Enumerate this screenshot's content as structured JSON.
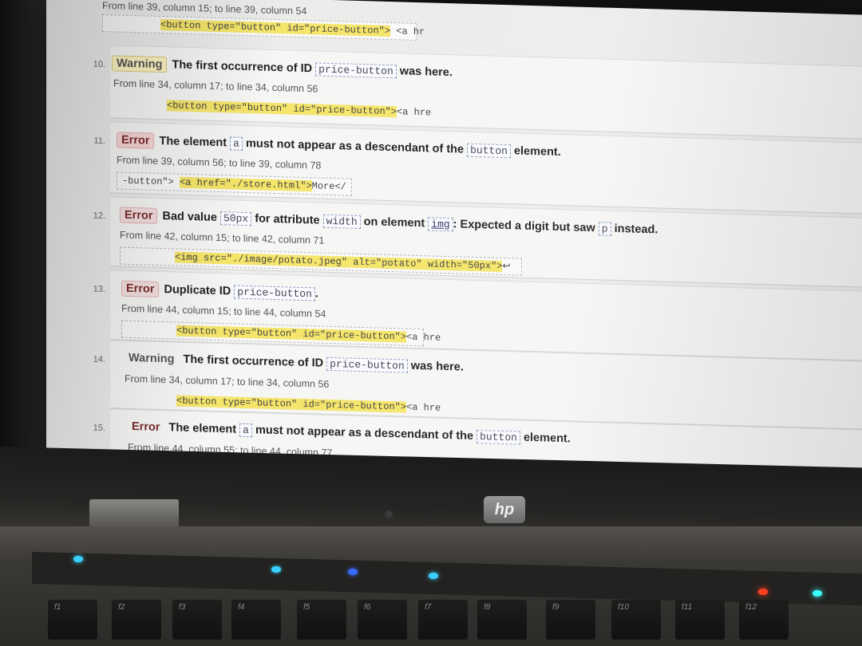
{
  "top_partial": {
    "location": "From line 39, column 15; to line 39, column 54",
    "extract_hl": "<button type=\"button\" id=\"price-button\">",
    "extract_rest": " <a hr"
  },
  "messages": [
    {
      "number": "10.",
      "type": "Warning",
      "parts": [
        "The first occurrence of ID ",
        "price-button",
        " was here."
      ],
      "location": "From line 34, column 17; to line 34, column 56",
      "extract_pre": "",
      "extract_hl": "<button type=\"button\" id=\"price-button\">",
      "extract_post": "<a hre"
    },
    {
      "number": "11.",
      "type": "Error",
      "parts": [
        "The element ",
        "a",
        " must not appear as a descendant of the ",
        "button",
        " element."
      ],
      "location": "From line 39, column 56; to line 39, column 78",
      "extract_pre": "-button\"> ",
      "extract_hl": "<a href=\"./store.html\">",
      "extract_post": "More</"
    },
    {
      "number": "12.",
      "type": "Error",
      "parts": [
        "Bad value ",
        "50px",
        " for attribute ",
        "width",
        " on element ",
        "img",
        ": Expected a digit but saw ",
        "p",
        " instead."
      ],
      "location": "From line 42, column 15; to line 42, column 71",
      "extract_pre": "",
      "extract_hl": "<img src=\"./image/potato.jpeg\" alt=\"potato\" width=\"50px\">",
      "extract_post": "↩"
    },
    {
      "number": "13.",
      "type": "Error",
      "parts": [
        "Duplicate ID ",
        "price-button",
        "."
      ],
      "location": "From line 44, column 15; to line 44, column 54",
      "extract_pre": "",
      "extract_hl": "<button type=\"button\" id=\"price-button\">",
      "extract_post": "<a hre"
    },
    {
      "number": "14.",
      "type": "Warning",
      "parts": [
        "The first occurrence of ID ",
        "price-button",
        " was here."
      ],
      "location": "From line 34, column 17; to line 34, column 56",
      "extract_pre": "",
      "extract_hl": "<button type=\"button\" id=\"price-button\">",
      "extract_post": "<a hre"
    },
    {
      "number": "15.",
      "type": "Error",
      "parts": [
        "The element ",
        "a",
        " must not appear as a descendant of the ",
        "button",
        " element."
      ],
      "location": "From line 44, column 55; to line 44, column 77"
    }
  ],
  "laptop": {
    "logo": "hp",
    "fkeys": [
      "f1",
      "f2",
      "f3",
      "f4",
      "f5",
      "f6",
      "f7",
      "f8",
      "f9",
      "f10",
      "f11",
      "f12"
    ],
    "colors": {
      "power_led": "#3ad0ff",
      "wifi_led": "#3a6bff",
      "battery_led": "#ff4020",
      "drive_led": "#3affff"
    }
  }
}
